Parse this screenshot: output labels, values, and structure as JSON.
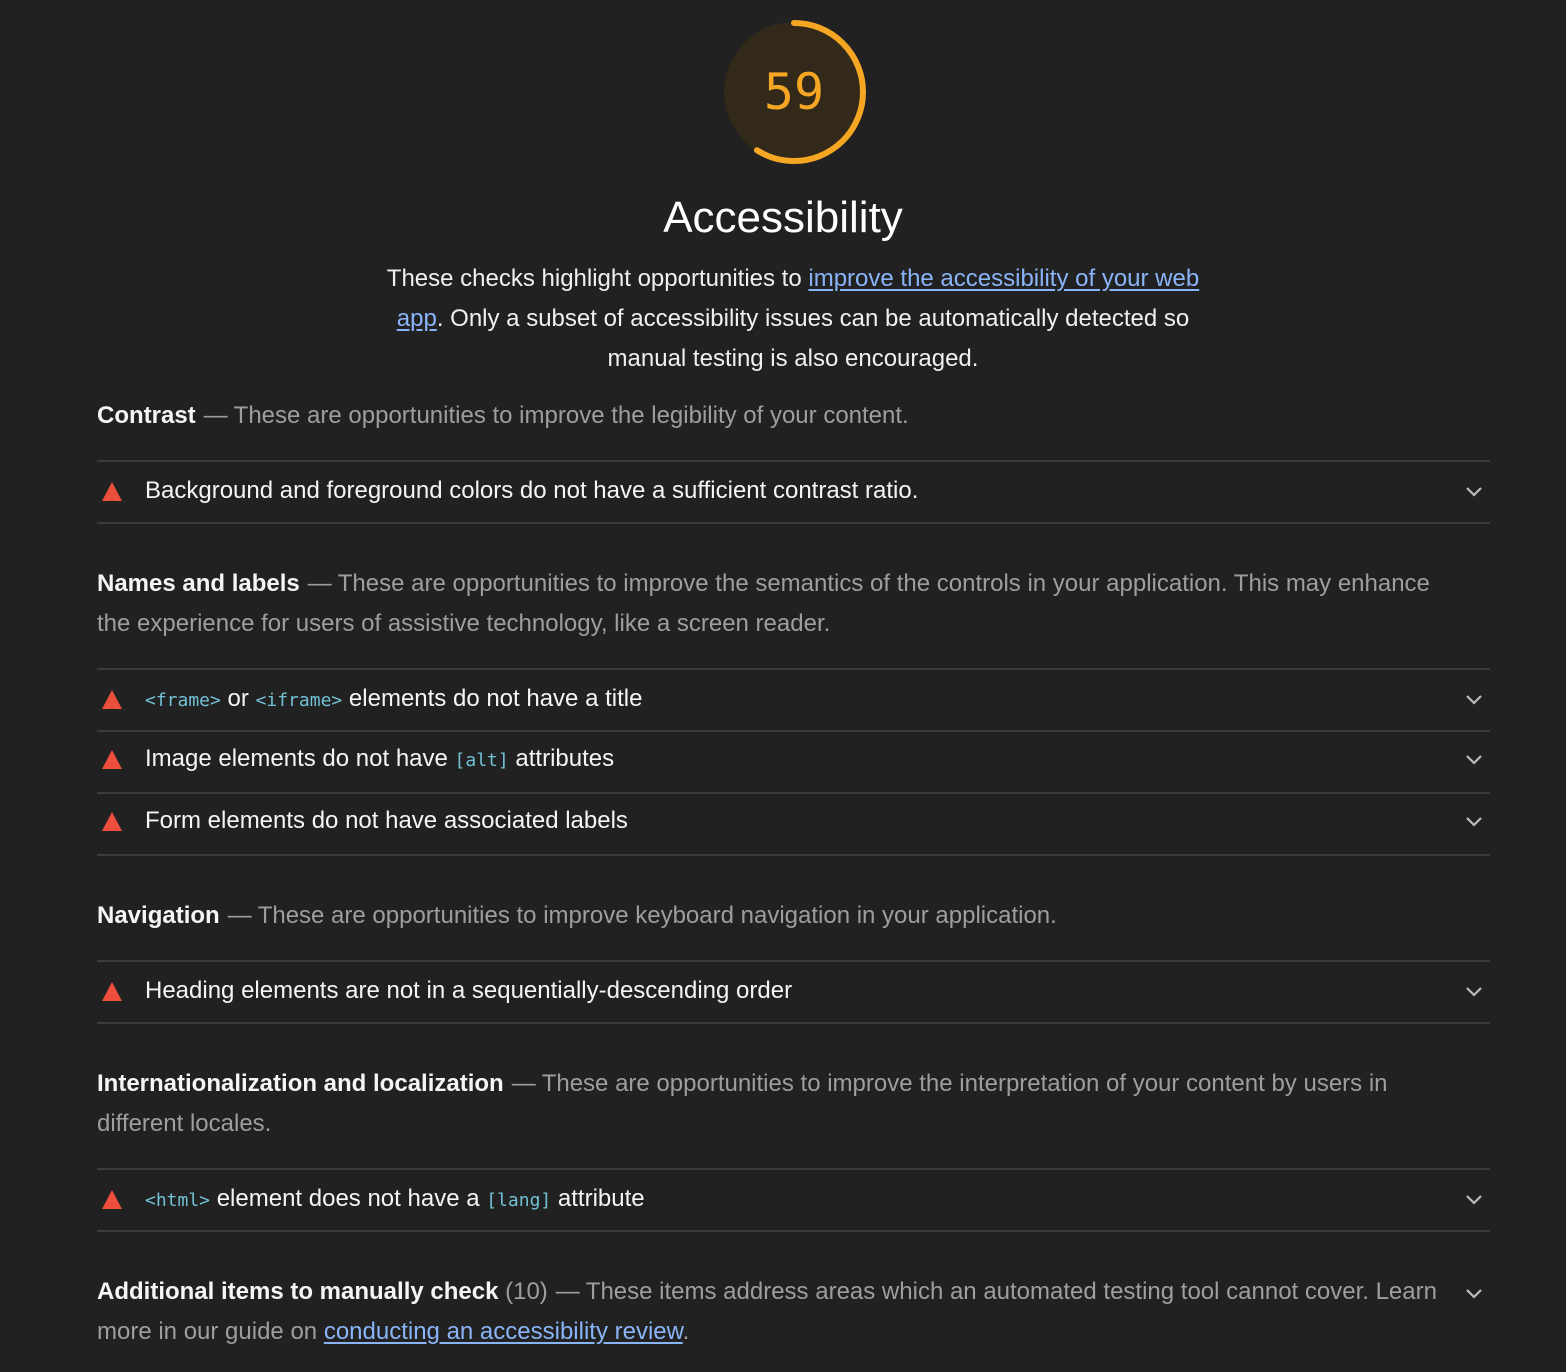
{
  "category": {
    "score": "59",
    "score_fraction": 0.59,
    "title": "Accessibility",
    "desc_before": "These checks highlight opportunities to ",
    "desc_link": "improve the accessibility of your web app",
    "desc_after": ". Only a subset of accessibility issues can be automatically detected so manual testing is also encouraged.",
    "score_color": "#f5a623"
  },
  "groups": {
    "contrast": {
      "name": "Contrast",
      "dash": "—",
      "desc": "These are opportunities to improve the legibility of your content."
    },
    "names": {
      "name": "Names and labels",
      "dash": "—",
      "desc": "These are opportunities to improve the semantics of the controls in your application. This may enhance the experience for users of assistive technology, like a screen reader."
    },
    "navigation": {
      "name": "Navigation",
      "dash": "—",
      "desc": "These are opportunities to improve keyboard navigation in your application."
    },
    "i18n": {
      "name": "Internationalization and localization",
      "dash": "—",
      "desc": "These are opportunities to improve the interpretation of your content by users in different locales."
    }
  },
  "audits": {
    "contrast": {
      "title": "Background and foreground colors do not have a sufficient contrast ratio."
    },
    "frame_title": {
      "code1": "<frame>",
      "text1": " or ",
      "code2": "<iframe>",
      "text2": " elements do not have a title"
    },
    "image_alt": {
      "text1": "Image elements do not have ",
      "code1": "[alt]",
      "text2": " attributes"
    },
    "label": {
      "title": "Form elements do not have associated labels"
    },
    "heading_order": {
      "title": "Heading elements are not in a sequentially-descending order"
    },
    "html_lang": {
      "code1": "<html>",
      "text1": " element does not have a ",
      "code2": "[lang]",
      "text2": " attribute"
    }
  },
  "manual": {
    "name": "Additional items to manually check",
    "count": "(10)",
    "dash": "—",
    "desc": "These items address areas which an automated testing tool cannot cover. Learn more in our guide on ",
    "link": "conducting an accessibility review",
    "after": "."
  },
  "colors": {
    "background": "#212121",
    "fail": "#eb4f3c",
    "link": "#8ab4f8",
    "code": "#72c1d5"
  },
  "icons": {
    "fail": "triangle-warning-icon",
    "expand": "chevron-down-icon"
  }
}
